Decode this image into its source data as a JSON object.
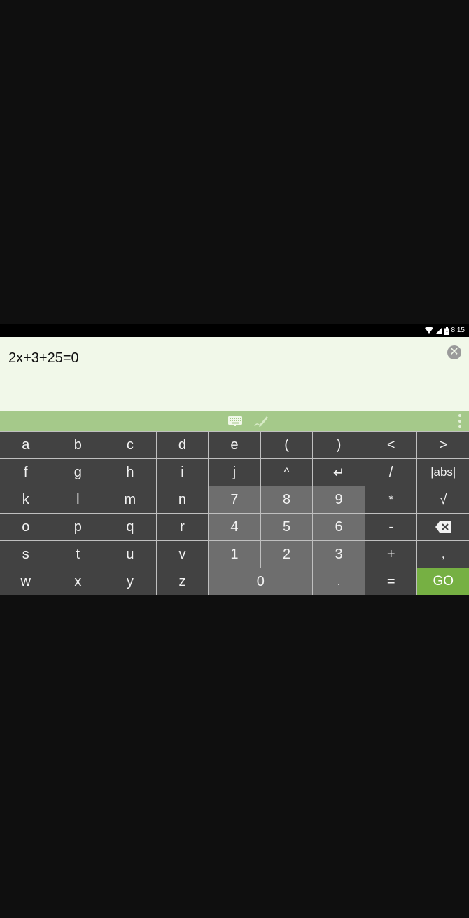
{
  "status_bar": {
    "time": "8:15",
    "icons": [
      "wifi-icon",
      "signal-icon",
      "battery-icon"
    ]
  },
  "input": {
    "expression": "2x+3+25=0",
    "clear_icon": "clear-icon"
  },
  "toolbar": {
    "icons": [
      "keyboard-icon",
      "handwriting-pen-icon",
      "overflow-menu-icon"
    ]
  },
  "keypad": {
    "rows": [
      [
        "a",
        "b",
        "c",
        "d",
        "e",
        "(",
        ")",
        "<",
        ">"
      ],
      [
        "f",
        "g",
        "h",
        "i",
        "j",
        "^",
        "↵",
        "/",
        "|abs|"
      ],
      [
        "k",
        "l",
        "m",
        "n",
        "7",
        "8",
        "9",
        "*",
        "√"
      ],
      [
        "o",
        "p",
        "q",
        "r",
        "4",
        "5",
        "6",
        "-",
        "backspace-icon"
      ],
      [
        "s",
        "t",
        "u",
        "v",
        "1",
        "2",
        "3",
        "+",
        ","
      ],
      [
        "w",
        "x",
        "y",
        "z",
        "0",
        ".",
        "=",
        "GO"
      ]
    ]
  },
  "colors": {
    "input_background": "#f1f8e9",
    "toolbar_background": "#a5c98a",
    "key_dark": "#424242",
    "key_numeric": "#6e6e6e",
    "go_key": "#76b043",
    "page_background": "#0f0f0f"
  }
}
